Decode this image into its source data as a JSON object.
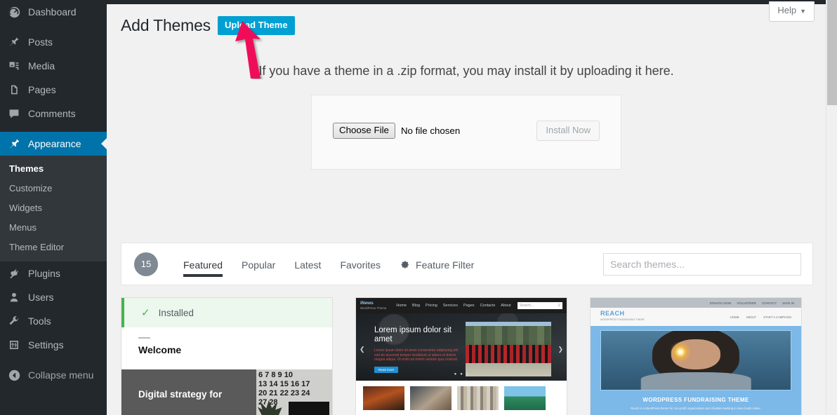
{
  "colors": {
    "sidebar_bg": "#23282d",
    "submenu_bg": "#32373c",
    "highlight_blue": "#0073aa",
    "button_blue": "#00a0d2",
    "installed_green": "#46b450",
    "annotation_pink": "#ef0b5a"
  },
  "sidebar": {
    "items": [
      {
        "label": "Dashboard",
        "icon": "dashboard-icon",
        "current": false
      },
      {
        "label": "Posts",
        "icon": "pin-icon",
        "current": false
      },
      {
        "label": "Media",
        "icon": "media-icon",
        "current": false
      },
      {
        "label": "Pages",
        "icon": "pages-icon",
        "current": false
      },
      {
        "label": "Comments",
        "icon": "comments-icon",
        "current": false
      },
      {
        "label": "Appearance",
        "icon": "paintbrush-icon",
        "current": true
      },
      {
        "label": "Plugins",
        "icon": "plug-icon",
        "current": false
      },
      {
        "label": "Users",
        "icon": "user-icon",
        "current": false
      },
      {
        "label": "Tools",
        "icon": "wrench-icon",
        "current": false
      },
      {
        "label": "Settings",
        "icon": "settings-icon",
        "current": false
      }
    ],
    "submenu": [
      {
        "label": "Themes",
        "current": true
      },
      {
        "label": "Customize",
        "current": false
      },
      {
        "label": "Widgets",
        "current": false
      },
      {
        "label": "Menus",
        "current": false
      },
      {
        "label": "Theme Editor",
        "current": false
      }
    ],
    "collapse": {
      "label": "Collapse menu",
      "icon": "collapse-arrow-icon"
    }
  },
  "header": {
    "help_label": "Help",
    "help_caret": "▼",
    "title": "Add Themes",
    "upload_button": "Upload Theme"
  },
  "upload": {
    "intro": "If you have a theme in a .zip format, you may install it by uploading it here.",
    "choose_file_label": "Choose File",
    "no_file_text": "No file chosen",
    "install_label": "Install Now"
  },
  "filter_bar": {
    "count": "15",
    "tabs": [
      {
        "label": "Featured",
        "active": true
      },
      {
        "label": "Popular",
        "active": false
      },
      {
        "label": "Latest",
        "active": false
      },
      {
        "label": "Favorites",
        "active": false
      }
    ],
    "feature_filter_label": "Feature Filter",
    "feature_filter_icon": "gear-icon",
    "search_placeholder": "Search themes...",
    "search_value": ""
  },
  "themes": [
    {
      "installed_label": "Installed",
      "check_icon": "check-icon",
      "welcome_title": "Welcome",
      "digital_text": "Digital strategy for",
      "calendar_rows": [
        "6  7  8  9  10",
        "13 14 15 16 17",
        "20 21 22 23 24",
        "27 28"
      ]
    },
    {
      "logo": "iNews",
      "logo_sub": "WordPress Theme",
      "nav": [
        "Home",
        "Blog",
        "Pricing",
        "Services",
        "Pages",
        "Contacts",
        "About"
      ],
      "search_placeholder": "Search...",
      "hero_title": "Lorem ipsum dolor sit amet",
      "hero_text": "Lorem ipsum dolor sit amet consectetur adipiscing elit sed do eiusmod tempor incididunt ut labore et dolore magna aliqua. Ut enim ad minim veniam quis nostrud.",
      "hero_button": "Read more",
      "prev_icon": "chevron-left-icon",
      "next_icon": "chevron-right-icon"
    },
    {
      "topbar_links": [
        "DONATE NOW",
        "VOLUNTEER",
        "CONTACT",
        "SIGN IN"
      ],
      "logo": "REACH",
      "logo_sub": "WORDPRESS FUNDRAISING THEME",
      "nav": [
        "HOME",
        "ABOUT",
        "START A CAMPAIGN"
      ],
      "title": "WORDPRESS FUNDRAISING THEME",
      "subtitle": "Reach is a WordPress theme for non-profit organizations and charities seeking to raise funds online."
    }
  ]
}
